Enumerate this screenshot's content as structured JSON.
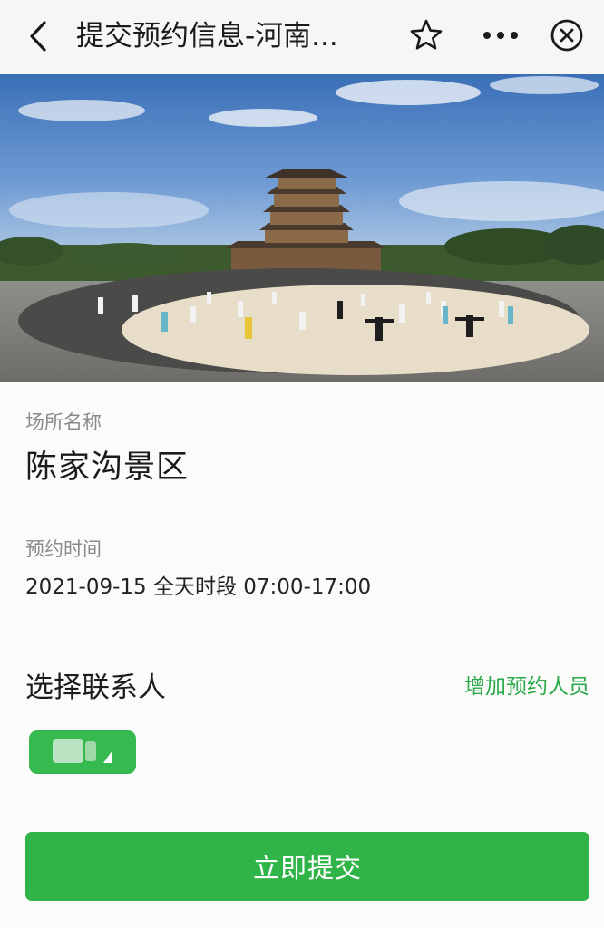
{
  "header": {
    "title": "提交预约信息-河南...",
    "back_icon": "chevron-left-icon",
    "star_icon": "star-outline-icon",
    "more_icon": "more-dots-icon",
    "close_icon": "close-circle-icon"
  },
  "hero_image": {
    "subject": "pagoda temple plaza with tai chi practitioners"
  },
  "venue": {
    "label": "场所名称",
    "name": "陈家沟景区"
  },
  "reservation_time": {
    "label": "预约时间",
    "value": "2021-09-15 全天时段 07:00-17:00"
  },
  "contact": {
    "title": "选择联系人",
    "add_link": "增加预约人员"
  },
  "submit": {
    "label": "立即提交"
  },
  "colors": {
    "accent_green": "#30b447",
    "link_green": "#2aa84a",
    "label_gray": "#8a8a8a"
  }
}
